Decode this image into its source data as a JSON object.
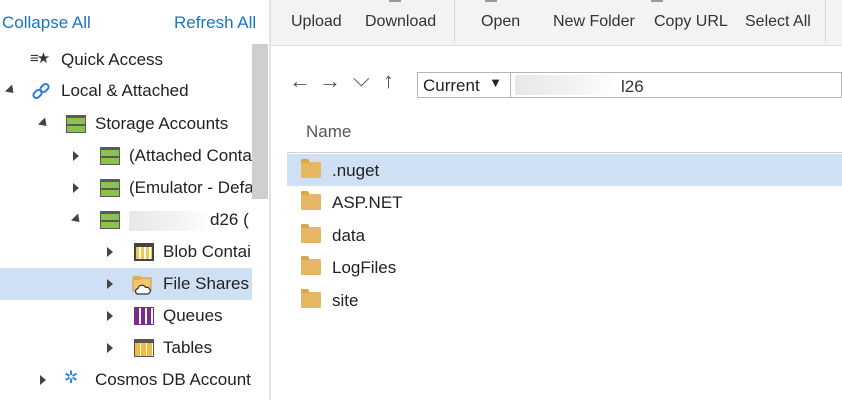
{
  "tree_header": {
    "collapse_all": "Collapse All",
    "refresh_all": "Refresh All"
  },
  "tree": {
    "quick_access": "Quick Access",
    "local_attached": "Local & Attached",
    "storage_accounts": "Storage Accounts",
    "attached_containers": "(Attached Conta",
    "emulator": "(Emulator - Defa",
    "account_suffix": "d26 (",
    "blob_containers": "Blob Contai",
    "file_shares": "File Shares",
    "queues": "Queues",
    "tables": "Tables",
    "cosmos_db": "Cosmos DB Account"
  },
  "toolbar": {
    "upload": "Upload",
    "download": "Download",
    "open": "Open",
    "new_folder": "New Folder",
    "copy_url": "Copy URL",
    "select_all": "Select All"
  },
  "address": {
    "back": "←",
    "forward": "→",
    "recent": "⌵",
    "up": "↑",
    "dropdown_value": "Current",
    "dropdown_arrow": "▼",
    "path_suffix": "l26"
  },
  "files": {
    "column_name": "Name",
    "items": [
      ".nuget",
      "ASP.NET",
      "data",
      "LogFiles",
      "site"
    ],
    "selected": ".nuget"
  },
  "colors": {
    "accent": "#1a73c8",
    "selection": "#cfe0f4",
    "folder": "#e6b663",
    "storage_green": "#8bc34a"
  }
}
